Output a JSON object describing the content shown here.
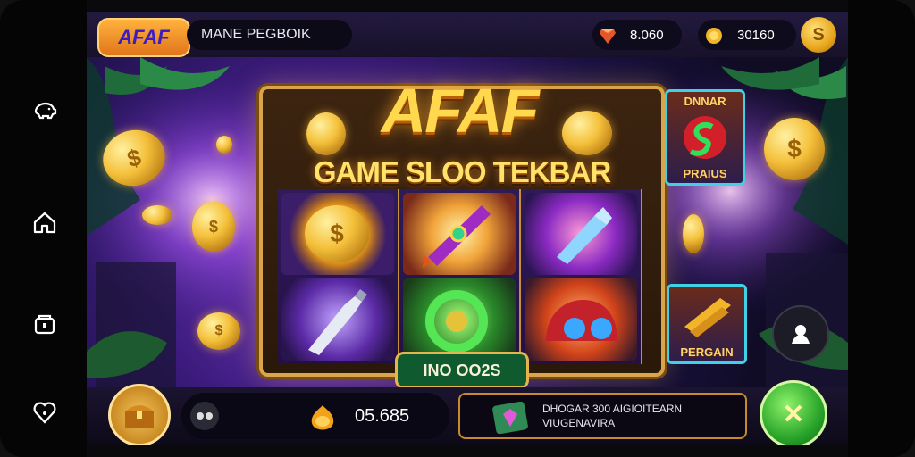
{
  "top_bar": {
    "logo_text": "AFAF",
    "username": "MANE PEGBOIK",
    "gems_value": "8.060",
    "coins_value": "30160",
    "coin_symbol": "S"
  },
  "game": {
    "title": "AFAF",
    "subtitle": "GAME SLOO TEKBAR",
    "win_label": "INO OO2S",
    "side_card_top_label_1": "DNNAR",
    "side_card_top_label_2": "PRAIUS",
    "side_card_bottom_label": "PERGAIN"
  },
  "bottom_bar": {
    "balance_value": "05.685",
    "message_line1": "DHOGAR 300 AIGIOITEARN",
    "message_line2": "VIUGENAVIRA",
    "spin_symbol": "✕"
  },
  "colors": {
    "accent_gold": "#ffd84d",
    "spin_green": "#2aa52a",
    "card_border": "#3fd2e6"
  }
}
